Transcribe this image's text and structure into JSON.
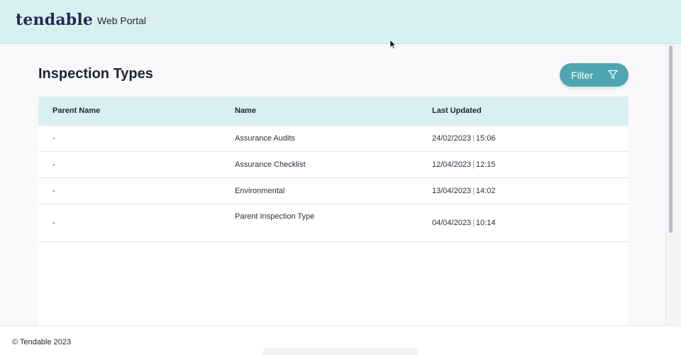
{
  "header": {
    "logo": "tendable",
    "portal_label": "Web Portal"
  },
  "page": {
    "title": "Inspection Types",
    "filter_label": "Filter"
  },
  "table": {
    "columns": [
      "Parent Name",
      "Name",
      "Last Updated"
    ],
    "rows": [
      {
        "parent": "-",
        "name": "Assurance Audits",
        "date": "24/02/2023",
        "time": "15:06"
      },
      {
        "parent": "-",
        "name": "Assurance Checklist",
        "date": "12/04/2023",
        "time": "12:15"
      },
      {
        "parent": "-",
        "name": "Environmental",
        "date": "13/04/2023",
        "time": "14:02"
      },
      {
        "parent": "-",
        "name": "Parent Inspection Type",
        "date": "04/04/2023",
        "time": "10:14"
      }
    ],
    "separator": "|"
  },
  "footer": {
    "copyright": "© Tendable 2023"
  },
  "colors": {
    "header_bg": "#d9f0f3",
    "accent": "#4fa6b0",
    "logo": "#1c2c52"
  },
  "icons": {
    "filter": "funnel-icon",
    "cursor": "mouse-pointer-icon"
  }
}
